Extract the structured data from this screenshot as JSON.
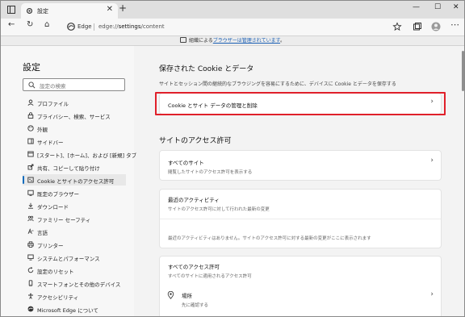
{
  "tab": {
    "title": "設定",
    "close": "✕"
  },
  "newtab_symbol": "+",
  "window_controls": {
    "minimize": "—",
    "maximize": "☐",
    "close": "✕"
  },
  "nav": {
    "back": "←",
    "refresh": "↻",
    "home": "⌂"
  },
  "address": {
    "browser_label": "Edge",
    "url_prefix": "edge://",
    "url_host": "settings",
    "url_path": "/content"
  },
  "banner": {
    "prefix": "組織による",
    "link": "ブラウザーは管理されています",
    "suffix": "。"
  },
  "sidebar": {
    "title": "設定",
    "search_placeholder": "設定の検索",
    "items": [
      {
        "label": "プロファイル",
        "icon": "profile-icon"
      },
      {
        "label": "プライバシー、検索、サービス",
        "icon": "privacy-lock-icon"
      },
      {
        "label": "外観",
        "icon": "appearance-icon"
      },
      {
        "label": "サイドバー",
        "icon": "sidebar-icon"
      },
      {
        "label": "[スタート]、[ホーム]、および [新規] タブ",
        "icon": "start-tab-icon"
      },
      {
        "label": "共有、コピーして貼り付け",
        "icon": "share-icon"
      },
      {
        "label": "Cookie とサイトのアクセス許可",
        "icon": "cookie-permissions-icon"
      },
      {
        "label": "既定のブラウザー",
        "icon": "default-browser-icon"
      },
      {
        "label": "ダウンロード",
        "icon": "download-icon"
      },
      {
        "label": "ファミリー セーフティ",
        "icon": "family-icon"
      },
      {
        "label": "言語",
        "icon": "language-icon"
      },
      {
        "label": "プリンター",
        "icon": "printer-icon"
      },
      {
        "label": "システムとパフォーマンス",
        "icon": "system-icon"
      },
      {
        "label": "設定のリセット",
        "icon": "reset-icon"
      },
      {
        "label": "スマートフォンとその他のデバイス",
        "icon": "phone-icon"
      },
      {
        "label": "アクセシビリティ",
        "icon": "accessibility-icon"
      },
      {
        "label": "Microsoft Edge について",
        "icon": "edge-icon"
      }
    ],
    "active_index": 6
  },
  "content": {
    "cookies_section": {
      "title": "保存された Cookie とデータ",
      "desc": "サイトとセッション間の継続的なブラウジングを容易にするために、デバイスに Cookie とデータを保存する",
      "manage_label": "Cookie とサイト データの管理と削除"
    },
    "permissions_section": {
      "title": "サイトのアクセス許可",
      "all_sites": {
        "title": "すべてのサイト",
        "sub": "閲覧したサイトのアクセス許可を表示する"
      },
      "recent": {
        "title": "最近のアクティビティ",
        "sub": "サイトのアクセス許可に対して行われた最新の変更",
        "empty": "最近のアクティビティはありません。サイトのアクセス許可に対する最新の変更がここに表示されます"
      },
      "all_permissions": {
        "title": "すべてのアクセス許可",
        "sub": "すべてのサイトに適用されるアクセス許可",
        "location_title": "場所",
        "location_sub": "先に確認する"
      }
    },
    "chevron": "›"
  },
  "colors": {
    "accent": "#0f6cbd",
    "highlight": "#e0202a",
    "link": "#1a5fb4"
  }
}
